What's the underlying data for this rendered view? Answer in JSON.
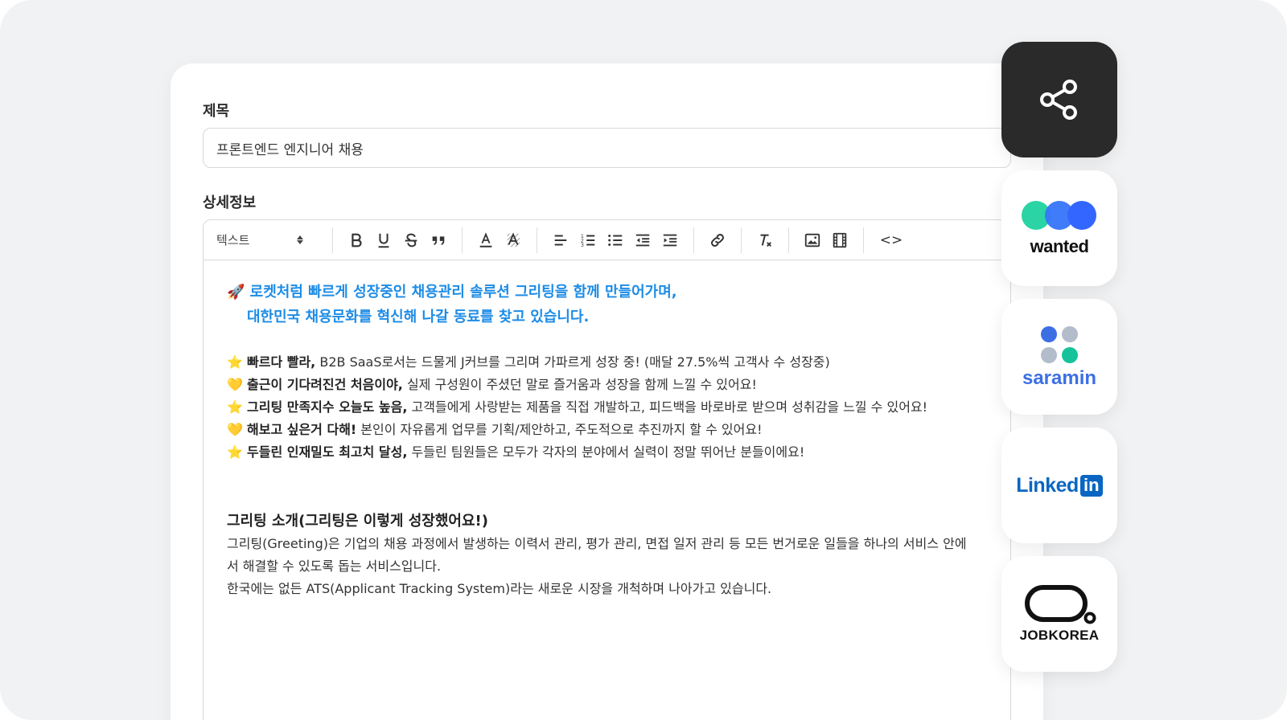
{
  "form": {
    "title_label": "제목",
    "title_value": "프론트엔드 엔지니어 채용",
    "detail_label": "상세정보"
  },
  "toolbar": {
    "format_select": "텍스트",
    "buttons": [
      "bold-icon",
      "underline-icon",
      "strikethrough-icon",
      "quote-icon",
      "text-color-icon",
      "highlight-icon",
      "align-left-icon",
      "ordered-list-icon",
      "bullet-list-icon",
      "outdent-icon",
      "indent-icon",
      "link-icon",
      "clear-format-icon",
      "image-icon",
      "video-icon",
      "code-icon"
    ],
    "code_label": "<>"
  },
  "content": {
    "intro_line1": "🚀 로켓처럼 빠르게 성장중인 채용관리 솔루션 그리팅을 함께 만들어가며,",
    "intro_line2": "대한민국 채용문화를 혁신해 나갈 동료를 찾고 있습니다.",
    "bullets": [
      {
        "emoji": "⭐",
        "bold": "빠르다 빨라,",
        "text": " B2B SaaS로서는 드물게 J커브를 그리며 가파르게 성장 중! (매달 27.5%씩 고객사 수 성장중)"
      },
      {
        "emoji": "💛",
        "bold": "출근이 기다려진건 처음이야,",
        "text": " 실제 구성원이 주셨던 말로 즐거움과 성장을 함께 느낄 수 있어요!"
      },
      {
        "emoji": "⭐",
        "bold": "그리팅 만족지수 오늘도 높음,",
        "text": " 고객들에게 사랑받는 제품을 직접 개발하고, 피드백을 바로바로 받으며 성취감을 느낄 수 있어요!"
      },
      {
        "emoji": "💛",
        "bold": "해보고 싶은거 다해!",
        "text": " 본인이 자유롭게 업무를 기획/제안하고, 주도적으로 추진까지 할 수 있어요!"
      },
      {
        "emoji": "⭐",
        "bold": "두들린 인재밀도 최고치 달성,",
        "text": " 두들린 팀원들은 모두가 각자의 분야에서 실력이 정말 뛰어난 분들이에요!"
      }
    ],
    "section_title": "그리팅 소개(그리팅은 이렇게 성장했어요!)",
    "section_line1": "그리팅(Greeting)은 기업의 채용 과정에서 발생하는 이력서 관리, 평가 관리, 면접 일저 관리 등 모든 번거로운 일들을 하나의 서비스 안에",
    "section_line2": "서 해결할 수 있도록 돕는 서비스입니다.",
    "section_line3": "한국에는 없든 ATS(Applicant Tracking System)라는 새로운 시장을 개척하며 나아가고 있습니다."
  },
  "share_tiles": {
    "share": "share-icon",
    "wanted": "wanted",
    "saramin": "saramin",
    "linkedin_text": "Linked",
    "linkedin_in": "in",
    "jobkorea": "JOBKOREA"
  },
  "colors": {
    "accent_blue": "#1d8ce6",
    "wanted_teal": "#2ad4a4",
    "wanted_blue": "#3366ff",
    "saramin_blue": "#3c6fe4",
    "saramin_teal": "#15c39a",
    "linkedin_blue": "#0a66c2",
    "share_tile_bg": "#2a2a2a"
  }
}
